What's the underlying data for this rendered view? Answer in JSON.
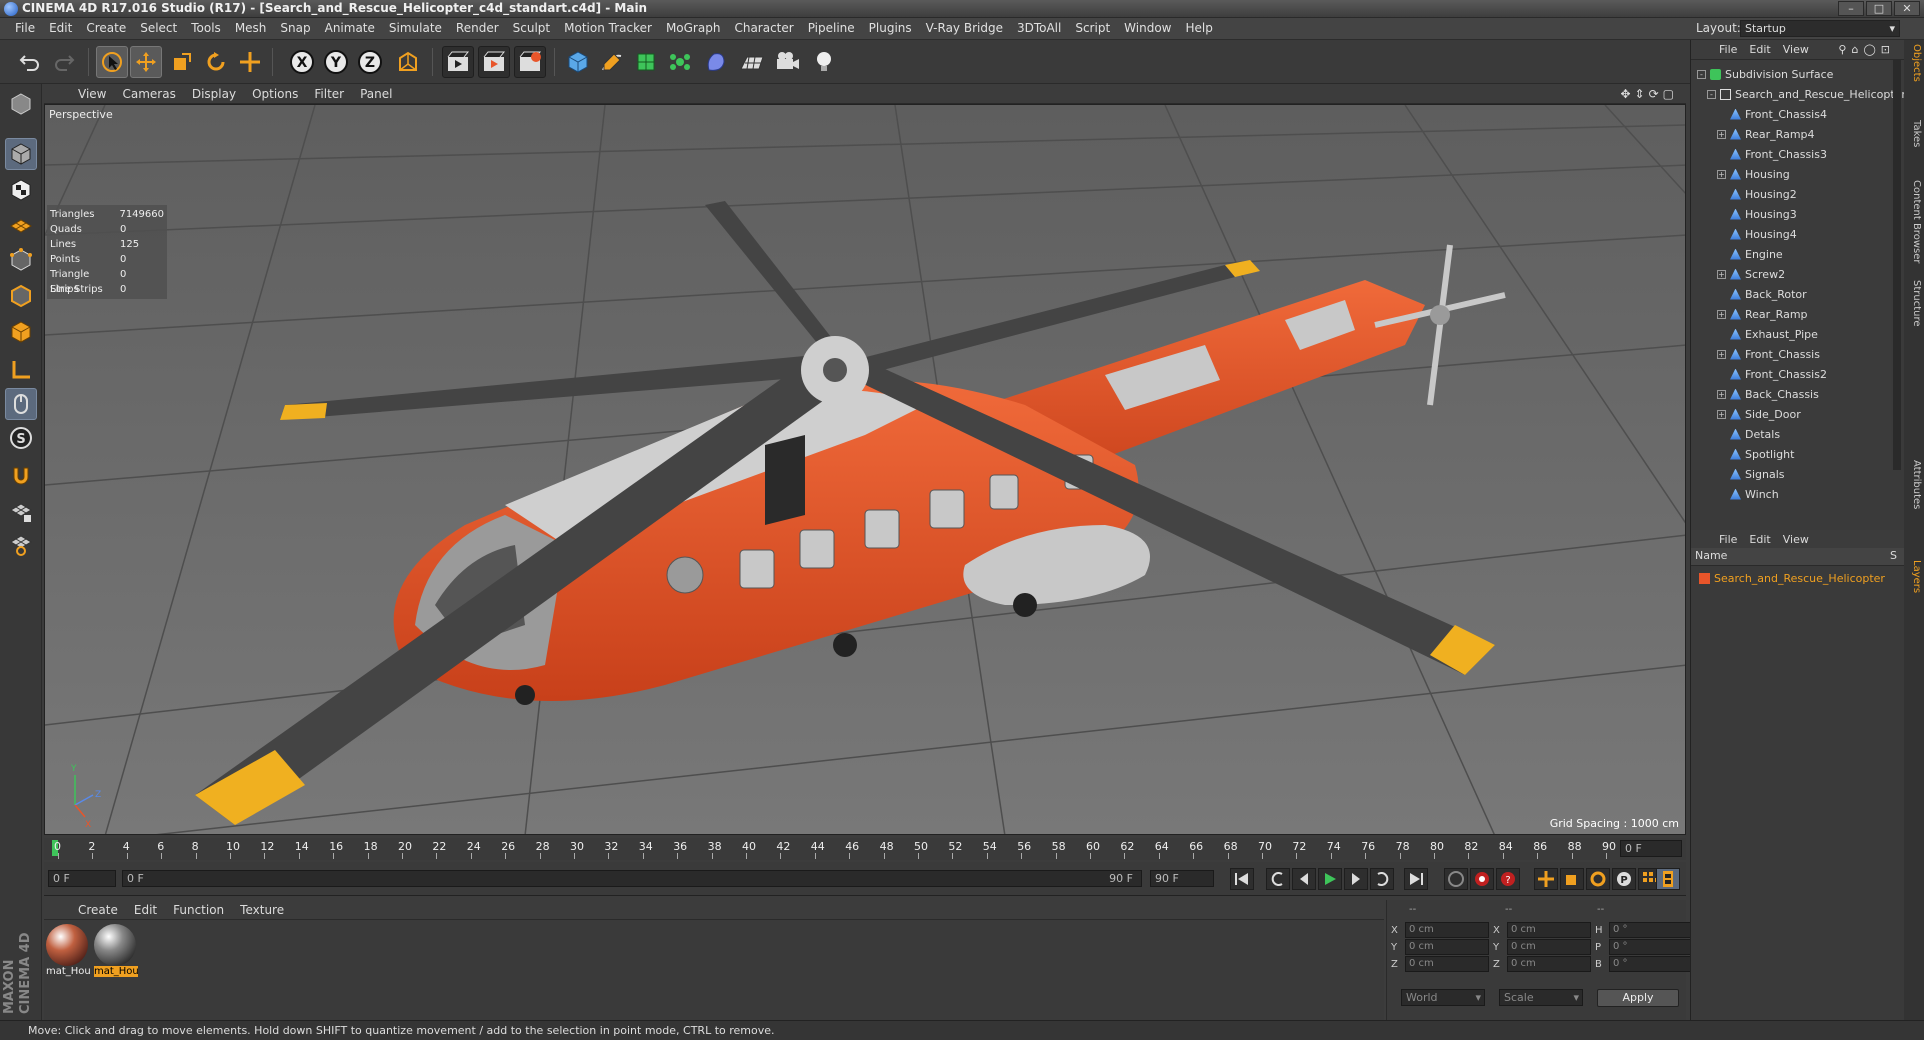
{
  "window": {
    "title": "CINEMA 4D R17.016 Studio (R17) - [Search_and_Rescue_Helicopter_c4d_standart.c4d] - Main"
  },
  "menubar": {
    "items": [
      "File",
      "Edit",
      "Create",
      "Select",
      "Tools",
      "Mesh",
      "Snap",
      "Animate",
      "Simulate",
      "Render",
      "Sculpt",
      "Motion Tracker",
      "MoGraph",
      "Character",
      "Pipeline",
      "Plugins",
      "V-Ray Bridge",
      "3DToAll",
      "Script",
      "Window",
      "Help"
    ],
    "layout_label": "Layout:",
    "layout_value": "Startup"
  },
  "toolbar": {
    "axis_x": "X",
    "axis_y": "Y",
    "axis_z": "Z"
  },
  "viewport": {
    "menu": [
      "View",
      "Cameras",
      "Display",
      "Options",
      "Filter",
      "Panel"
    ],
    "label": "Perspective",
    "stats": [
      {
        "k": "Triangles",
        "v": "7149660"
      },
      {
        "k": "Quads",
        "v": "0"
      },
      {
        "k": "Lines",
        "v": "125"
      },
      {
        "k": "Points",
        "v": "0"
      },
      {
        "k": "Triangle Strips",
        "v": "0"
      },
      {
        "k": "Line Strips",
        "v": "0"
      }
    ],
    "grid_spacing": "Grid Spacing : 1000 cm"
  },
  "timeline": {
    "ticks": [
      "0",
      "2",
      "4",
      "6",
      "8",
      "10",
      "12",
      "14",
      "16",
      "18",
      "20",
      "22",
      "24",
      "26",
      "28",
      "30",
      "32",
      "34",
      "36",
      "38",
      "40",
      "42",
      "44",
      "46",
      "48",
      "50",
      "52",
      "54",
      "56",
      "58",
      "60",
      "62",
      "64",
      "66",
      "68",
      "70",
      "72",
      "74",
      "76",
      "78",
      "80",
      "82",
      "84",
      "86",
      "88",
      "90"
    ],
    "current_frame_display": "0 F",
    "start_field": "0 F",
    "range_start": "0 F",
    "range_end": "90 F",
    "end_field": "90 F"
  },
  "materials": {
    "menu": [
      "Create",
      "Edit",
      "Function",
      "Texture"
    ],
    "items": [
      {
        "label": "mat_Hou",
        "selected": false
      },
      {
        "label": "mat_Hou",
        "selected": true
      }
    ]
  },
  "coordinates": {
    "header_left": "--",
    "header_mid": "--",
    "header_right": "--",
    "rows": [
      {
        "l1": "X",
        "v1": "0 cm",
        "l2": "X",
        "v2": "0 cm",
        "l3": "H",
        "v3": "0 °"
      },
      {
        "l1": "Y",
        "v1": "0 cm",
        "l2": "Y",
        "v2": "0 cm",
        "l3": "P",
        "v3": "0 °"
      },
      {
        "l1": "Z",
        "v1": "0 cm",
        "l2": "Z",
        "v2": "0 cm",
        "l3": "B",
        "v3": "0 °"
      }
    ],
    "mode_world": "World",
    "mode_scale": "Scale",
    "apply": "Apply"
  },
  "objects_panel": {
    "menu": [
      "File",
      "Edit",
      "View"
    ],
    "items": [
      {
        "name": "Subdivision Surface",
        "depth": 0,
        "expand": "-",
        "icon": "subdiv"
      },
      {
        "name": "Search_and_Rescue_Helicopter",
        "depth": 1,
        "expand": "-",
        "icon": "null"
      },
      {
        "name": "Front_Chassis4",
        "depth": 2,
        "expand": "",
        "icon": "bone"
      },
      {
        "name": "Rear_Ramp4",
        "depth": 2,
        "expand": "+",
        "icon": "bone"
      },
      {
        "name": "Front_Chassis3",
        "depth": 2,
        "expand": "",
        "icon": "bone"
      },
      {
        "name": "Housing",
        "depth": 2,
        "expand": "+",
        "icon": "bone"
      },
      {
        "name": "Housing2",
        "depth": 2,
        "expand": "",
        "icon": "bone"
      },
      {
        "name": "Housing3",
        "depth": 2,
        "expand": "",
        "icon": "bone"
      },
      {
        "name": "Housing4",
        "depth": 2,
        "expand": "",
        "icon": "bone"
      },
      {
        "name": "Engine",
        "depth": 2,
        "expand": "",
        "icon": "bone"
      },
      {
        "name": "Screw2",
        "depth": 2,
        "expand": "+",
        "icon": "bone"
      },
      {
        "name": "Back_Rotor",
        "depth": 2,
        "expand": "",
        "icon": "bone"
      },
      {
        "name": "Rear_Ramp",
        "depth": 2,
        "expand": "+",
        "icon": "bone"
      },
      {
        "name": "Exhaust_Pipe",
        "depth": 2,
        "expand": "",
        "icon": "bone"
      },
      {
        "name": "Front_Chassis",
        "depth": 2,
        "expand": "+",
        "icon": "bone"
      },
      {
        "name": "Front_Chassis2",
        "depth": 2,
        "expand": "",
        "icon": "bone"
      },
      {
        "name": "Back_Chassis",
        "depth": 2,
        "expand": "+",
        "icon": "bone"
      },
      {
        "name": "Side_Door",
        "depth": 2,
        "expand": "+",
        "icon": "bone"
      },
      {
        "name": "Detals",
        "depth": 2,
        "expand": "",
        "icon": "bone"
      },
      {
        "name": "Spotlight",
        "depth": 2,
        "expand": "",
        "icon": "bone"
      },
      {
        "name": "Signals",
        "depth": 2,
        "expand": "",
        "icon": "bone"
      },
      {
        "name": "Winch",
        "depth": 2,
        "expand": "",
        "icon": "bone"
      }
    ]
  },
  "layers_panel": {
    "menu": [
      "File",
      "Edit",
      "View"
    ],
    "column_name": "Name",
    "column_s": "S",
    "item": "Search_and_Rescue_Helicopter"
  },
  "side_tabs": [
    "Objects",
    "Takes",
    "Content Browser",
    "Structure",
    "Attributes",
    "Layers"
  ],
  "brand": "MAXON CINEMA 4D",
  "status": "Move: Click and drag to move elements. Hold down SHIFT to quantize movement / add to the selection in point mode, CTRL to remove.",
  "colors": {
    "accent": "#f0a020",
    "orange": "#e8552a",
    "selection": "#5c6a7e"
  }
}
